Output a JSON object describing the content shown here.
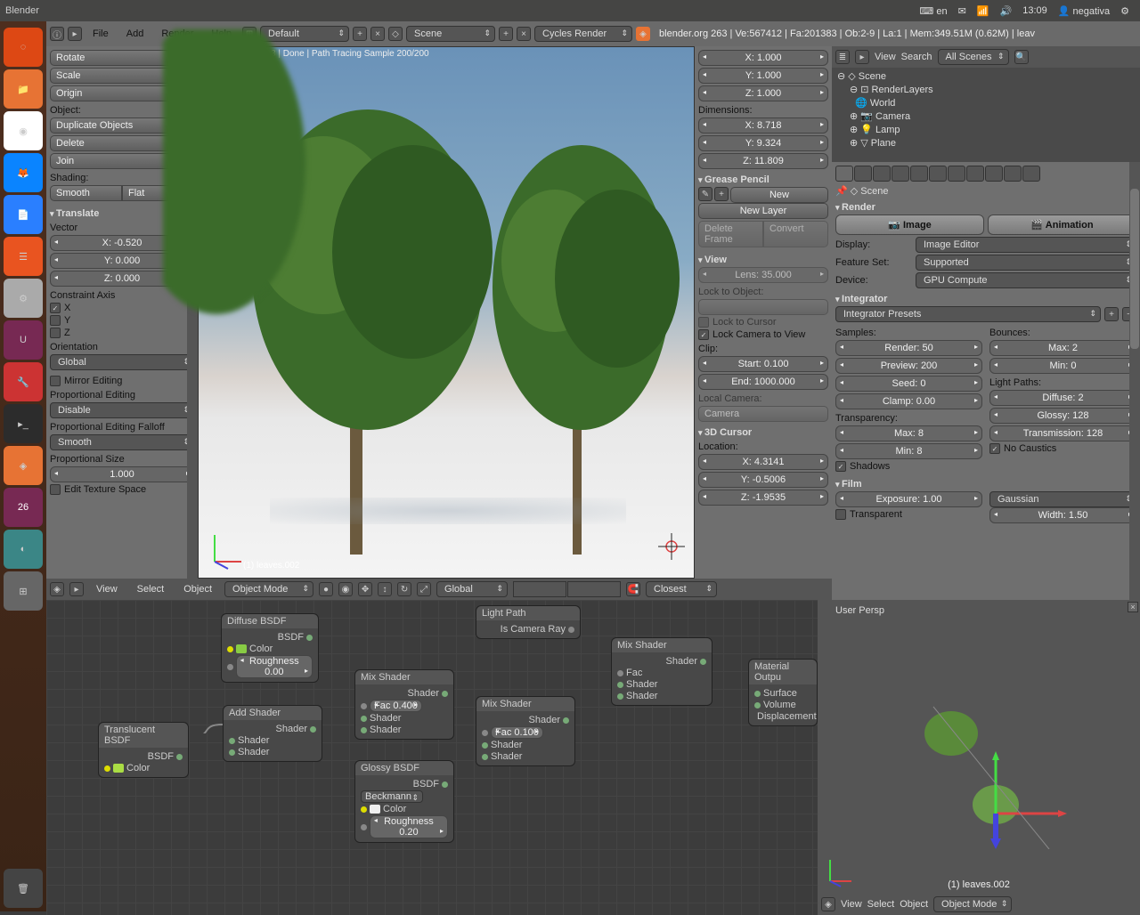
{
  "titlebar": {
    "app": "Blender",
    "lang": "en",
    "time": "13:09",
    "user": "negativa"
  },
  "topmenu": {
    "file": "File",
    "add": "Add",
    "render": "Render",
    "help": "Help",
    "layout": "Default",
    "scene": "Scene",
    "engine": "Cycles Render",
    "stats": "blender.org 263 | Ve:567412 | Fa:201383 | Ob:2-9 | La:1 | Mem:349.51M (0.62M) | leav"
  },
  "tool": {
    "rotate": "Rotate",
    "scale": "Scale",
    "origin": "Origin",
    "object_lbl": "Object:",
    "dup": "Duplicate Objects",
    "del": "Delete",
    "join": "Join",
    "shading_lbl": "Shading:",
    "smooth": "Smooth",
    "flat": "Flat",
    "translate": "Translate",
    "vector": "Vector",
    "vx": "X: -0.520",
    "vy": "Y: 0.000",
    "vz": "Z: 0.000",
    "constraint": "Constraint Axis",
    "ax": "X",
    "ay": "Y",
    "az": "Z",
    "orient": "Orientation",
    "global": "Global",
    "mirror": "Mirror Editing",
    "propedit": "Proportional Editing",
    "disable": "Disable",
    "falloff": "Proportional Editing Falloff",
    "smooth2": "Smooth",
    "propsize": "Proportional Size",
    "psize": "1.000",
    "texspace": "Edit Texture Space"
  },
  "viewport": {
    "status": "Elapsed: 01:07.33 | Done | Path Tracing Sample 200/200",
    "obj": "(1) leaves.002"
  },
  "npanel": {
    "x": "X: 1.000",
    "y": "Y: 1.000",
    "z": "Z: 1.000",
    "dims": "Dimensions:",
    "dx": "X: 8.718",
    "dy": "Y: 9.324",
    "dz": "Z: 11.809",
    "gp": "Grease Pencil",
    "new": "New",
    "newlayer": "New Layer",
    "delframe": "Delete Frame",
    "convert": "Convert",
    "view": "View",
    "lens": "Lens: 35.000",
    "lockobj": "Lock to Object:",
    "lockcur": "Lock to Cursor",
    "lockcam": "Lock Camera to View",
    "clip": "Clip:",
    "start": "Start: 0.100",
    "end": "End: 1000.000",
    "localcam": "Local Camera:",
    "camera": "Camera",
    "cursor3d": "3D Cursor",
    "loc": "Location:",
    "cx": "X: 4.3141",
    "cy": "Y: -0.5006",
    "cz": "Z: -1.9535"
  },
  "header3d": {
    "view": "View",
    "select": "Select",
    "object": "Object",
    "mode": "Object Mode",
    "global": "Global",
    "snap": "Closest"
  },
  "outliner": {
    "view": "View",
    "search": "Search",
    "scope": "All Scenes",
    "scene": "Scene",
    "rl": "RenderLayers",
    "world": "World",
    "cam": "Camera",
    "lamp": "Lamp",
    "plane": "Plane"
  },
  "props": {
    "scene": "Scene",
    "render": "Render",
    "image": "Image",
    "anim": "Animation",
    "display": "Display:",
    "display_v": "Image Editor",
    "feat": "Feature Set:",
    "feat_v": "Supported",
    "device": "Device:",
    "device_v": "GPU Compute",
    "integrator": "Integrator",
    "presets": "Integrator Presets",
    "samples": "Samples:",
    "bounces": "Bounces:",
    "rsamples": "Render: 50",
    "psamples": "Preview: 200",
    "seed": "Seed: 0",
    "clamp": "Clamp: 0.00",
    "bmax": "Max: 2",
    "bmin": "Min: 0",
    "lightpaths": "Light Paths:",
    "diffuse": "Diffuse: 2",
    "glossy": "Glossy: 128",
    "trans": "Transmission: 128",
    "transp": "Transparency:",
    "tmax": "Max: 8",
    "tmin": "Min: 8",
    "nocaustics": "No Caustics",
    "shadows": "Shadows",
    "film": "Film",
    "exposure": "Exposure: 1.00",
    "filter": "Gaussian",
    "transparent": "Transparent",
    "fwidth": "Width: 1.50"
  },
  "nodes": {
    "diffuse": "Diffuse BSDF",
    "bsdf": "BSDF",
    "color": "Color",
    "rough0": "Roughness 0.00",
    "translucent": "Translucent BSDF",
    "addsh": "Add Shader",
    "shader": "Shader",
    "mix": "Mix Shader",
    "fac04": "Fac 0.400",
    "fac01": "Fac 0.100",
    "fac": "Fac",
    "glossy": "Glossy BSDF",
    "beckmann": "Beckmann",
    "rough02": "Roughness 0.20",
    "lightpath": "Light Path",
    "iscam": "Is Camera Ray",
    "matout": "Material Outpu",
    "surface": "Surface",
    "volume": "Volume",
    "disp": "Displacement"
  },
  "mini": {
    "persp": "User Persp",
    "obj": "(1) leaves.002",
    "view": "View",
    "select": "Select",
    "object": "Object",
    "mode": "Object Mode"
  }
}
